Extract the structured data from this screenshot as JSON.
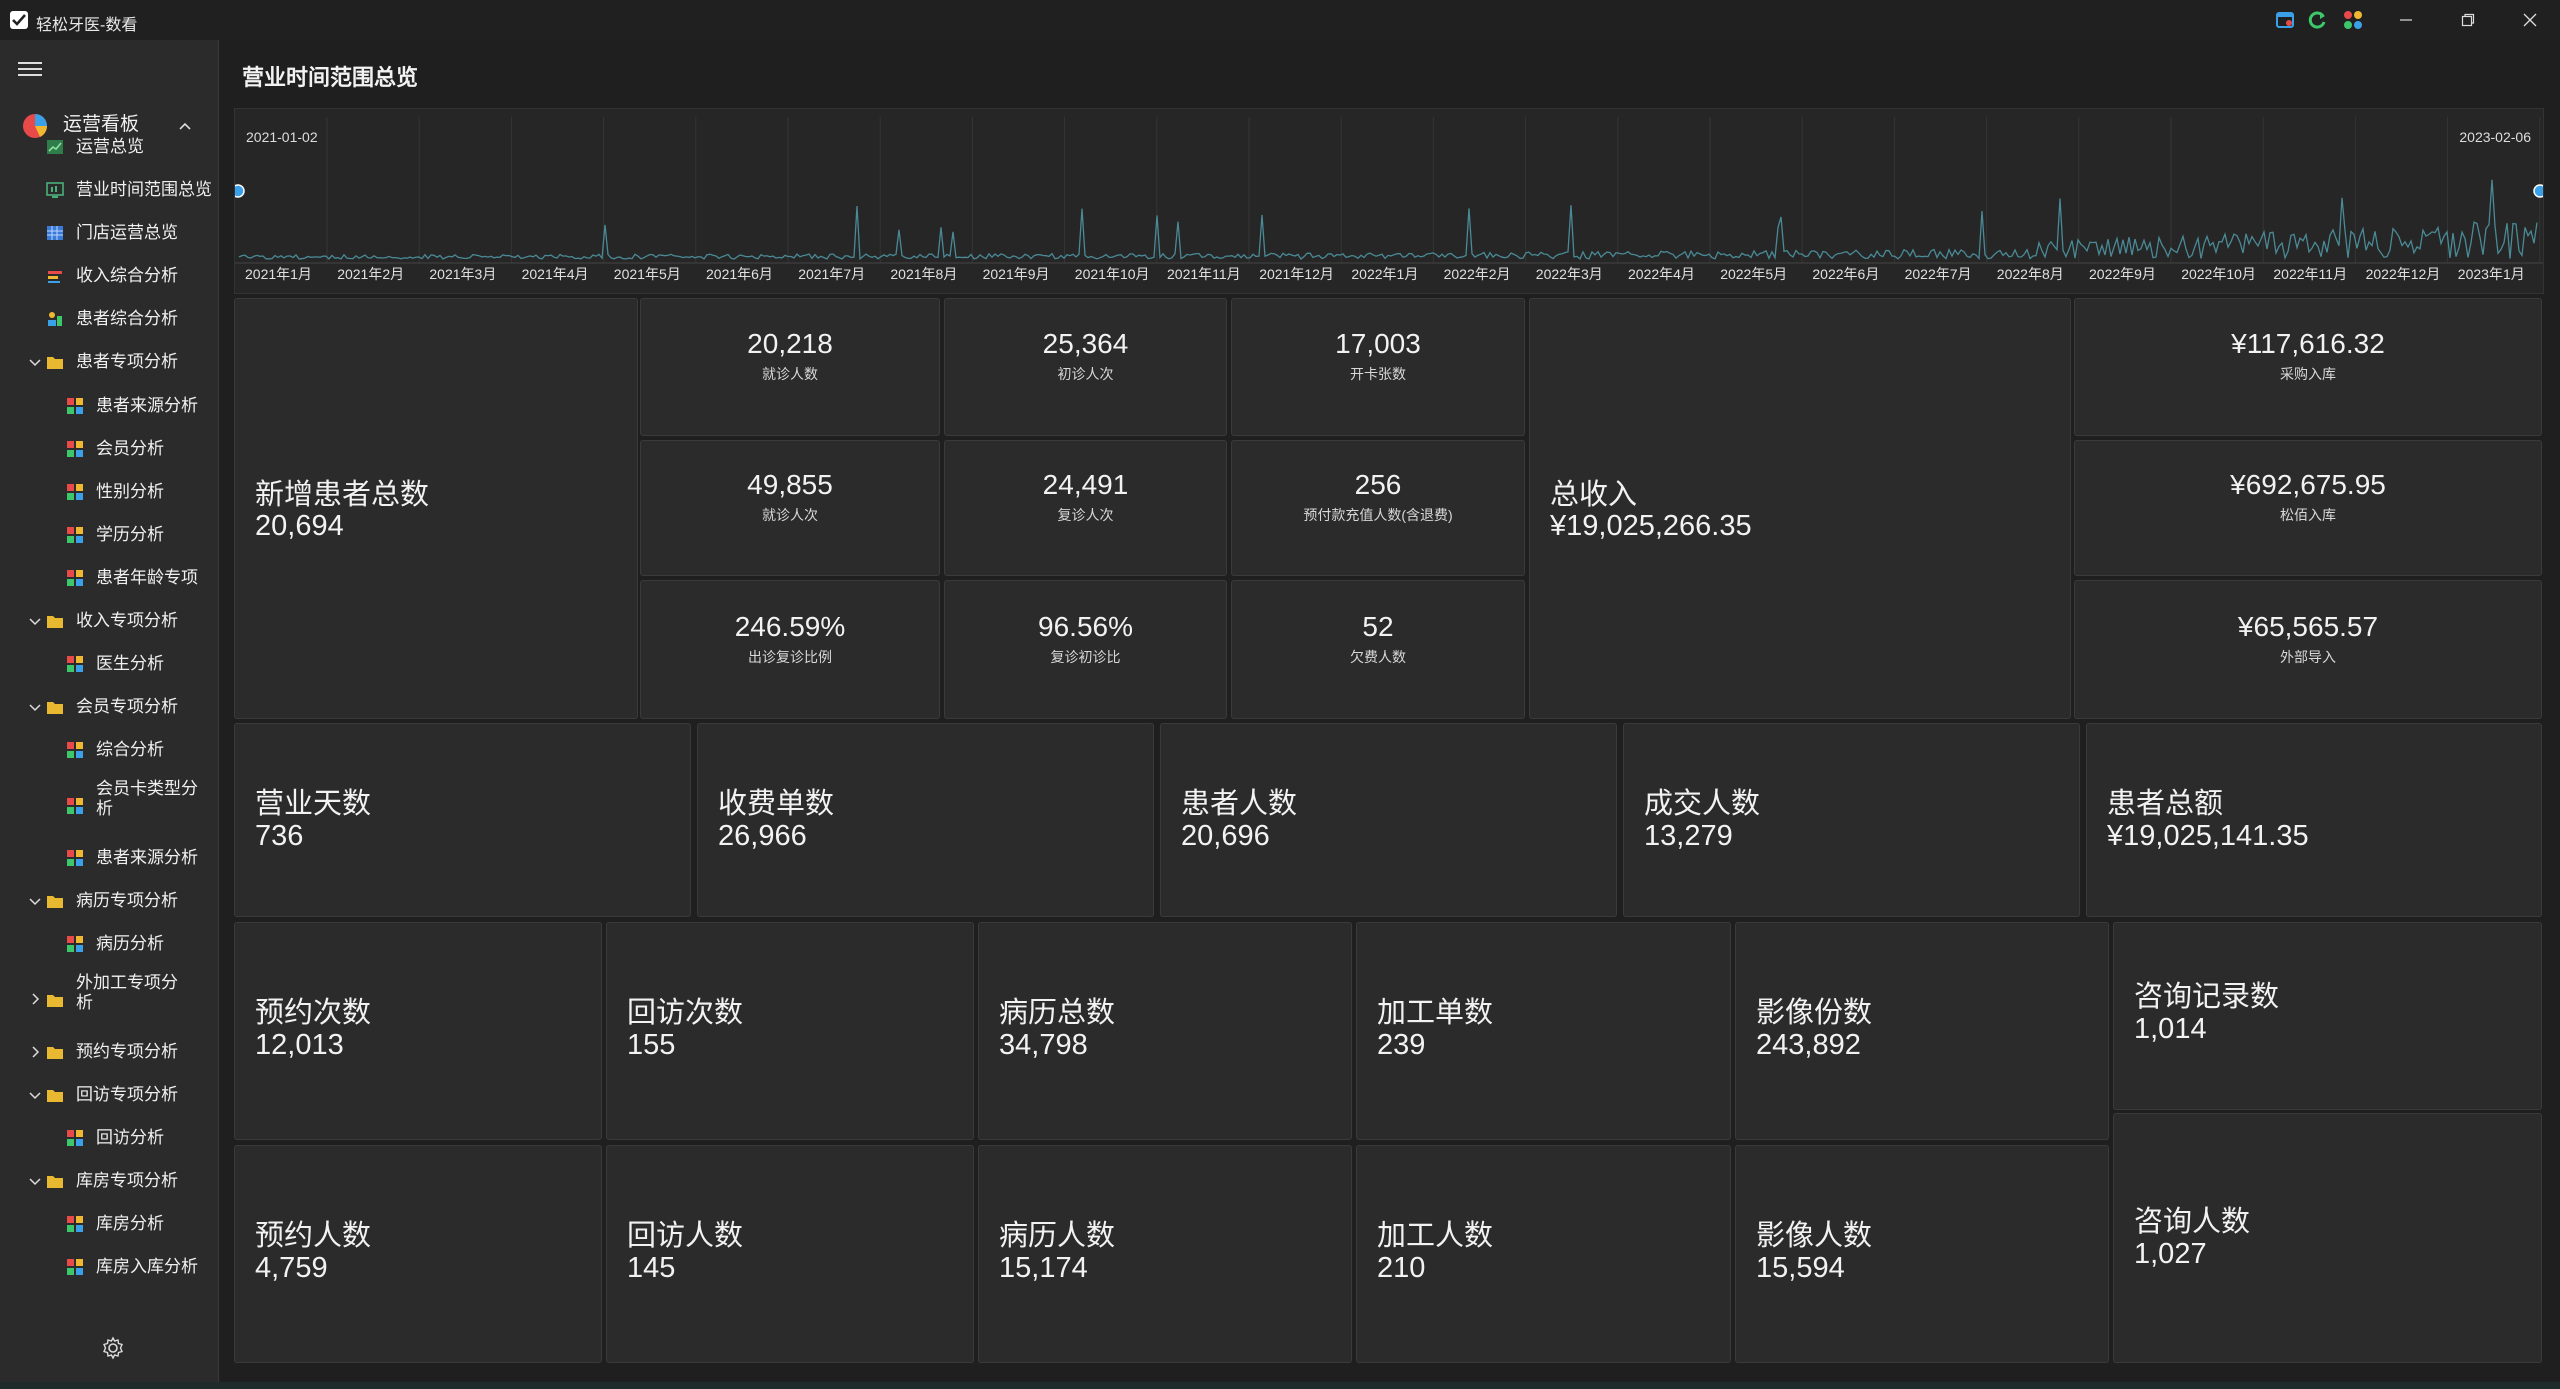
{
  "window": {
    "title": "轻松牙医-数看"
  },
  "sidebar": {
    "root": {
      "label": "运营看板"
    },
    "items": [
      {
        "label": "运营总览",
        "icon": "chart-line-icon"
      },
      {
        "label": "营业时间范围总览",
        "icon": "monitor-chart-icon"
      },
      {
        "label": "门店运营总览",
        "icon": "table-grid-icon"
      },
      {
        "label": "收入综合分析",
        "icon": "bar-chart-icon"
      },
      {
        "label": "患者综合分析",
        "icon": "people-chart-icon"
      },
      {
        "label": "患者专项分析",
        "icon": "folder-icon"
      },
      {
        "label": "患者来源分析",
        "icon": "widget-icon"
      },
      {
        "label": "会员分析",
        "icon": "widget-icon"
      },
      {
        "label": "性别分析",
        "icon": "widget-icon"
      },
      {
        "label": "学历分析",
        "icon": "widget-icon"
      },
      {
        "label": "患者年龄专项",
        "icon": "widget-icon"
      },
      {
        "label": "收入专项分析",
        "icon": "folder-icon"
      },
      {
        "label": "医生分析",
        "icon": "widget-icon"
      },
      {
        "label": "会员专项分析",
        "icon": "folder-icon"
      },
      {
        "label": "综合分析",
        "icon": "widget-icon"
      },
      {
        "label": "会员卡类型分析",
        "icon": "widget-icon"
      },
      {
        "label": "患者来源分析",
        "icon": "widget-icon"
      },
      {
        "label": "病历专项分析",
        "icon": "folder-icon"
      },
      {
        "label": "病历分析",
        "icon": "widget-icon"
      },
      {
        "label": "外加工专项分析",
        "icon": "folder-icon"
      },
      {
        "label": "预约专项分析",
        "icon": "folder-icon"
      },
      {
        "label": "回访专项分析",
        "icon": "folder-icon"
      },
      {
        "label": "回访分析",
        "icon": "widget-icon"
      },
      {
        "label": "库房专项分析",
        "icon": "folder-icon"
      },
      {
        "label": "库房分析",
        "icon": "widget-icon"
      },
      {
        "label": "库房入库分析",
        "icon": "widget-icon"
      }
    ]
  },
  "main": {
    "title": "营业时间范围总览",
    "timeline": {
      "start": "2021-01-02",
      "end": "2023-02-06",
      "months": [
        "2021年1月",
        "2021年2月",
        "2021年3月",
        "2021年4月",
        "2021年5月",
        "2021年6月",
        "2021年7月",
        "2021年8月",
        "2021年9月",
        "2021年10月",
        "2021年11月",
        "2021年12月",
        "2022年1月",
        "2022年2月",
        "2022年3月",
        "2022年4月",
        "2022年5月",
        "2022年6月",
        "2022年7月",
        "2022年8月",
        "2022年9月",
        "2022年10月",
        "2022年11月",
        "2022年12月",
        "2023年1月"
      ]
    },
    "new_patients": {
      "label": "新增患者总数",
      "value": "20,694"
    },
    "total_income": {
      "label": "总收入",
      "value": "¥19,025,266.35"
    },
    "small_stats": [
      {
        "value": "20,218",
        "label": "就诊人数"
      },
      {
        "value": "25,364",
        "label": "初诊人次"
      },
      {
        "value": "17,003",
        "label": "开卡张数"
      },
      {
        "value": "49,855",
        "label": "就诊人次"
      },
      {
        "value": "24,491",
        "label": "复诊人次"
      },
      {
        "value": "256",
        "label": "预付款充值人数(含退费)"
      },
      {
        "value": "246.59%",
        "label": "出诊复诊比例"
      },
      {
        "value": "96.56%",
        "label": "复诊初诊比"
      },
      {
        "value": "52",
        "label": "欠费人数"
      }
    ],
    "stock_stats": [
      {
        "value": "¥117,616.32",
        "label": "采购入库"
      },
      {
        "value": "¥692,675.95",
        "label": "松佰入库"
      },
      {
        "value": "¥65,565.57",
        "label": "外部导入"
      }
    ],
    "row2": [
      {
        "label": "营业天数",
        "value": "736"
      },
      {
        "label": "收费单数",
        "value": "26,966"
      },
      {
        "label": "患者人数",
        "value": "20,696"
      },
      {
        "label": "成交人数",
        "value": "13,279"
      },
      {
        "label": "患者总额",
        "value": "¥19,025,141.35"
      }
    ],
    "row3": [
      {
        "label": "预约次数",
        "value": "12,013"
      },
      {
        "label": "回访次数",
        "value": "155"
      },
      {
        "label": "病历总数",
        "value": "34,798"
      },
      {
        "label": "加工单数",
        "value": "239"
      },
      {
        "label": "影像份数",
        "value": "243,892"
      },
      {
        "label": "咨询记录数",
        "value": "1,014"
      }
    ],
    "row4": [
      {
        "label": "预约人数",
        "value": "4,759"
      },
      {
        "label": "回访人数",
        "value": "145"
      },
      {
        "label": "病历人数",
        "value": "15,174"
      },
      {
        "label": "加工人数",
        "value": "210"
      },
      {
        "label": "影像人数",
        "value": "15,594"
      },
      {
        "label": "咨询人数",
        "value": "1,027"
      }
    ]
  },
  "colors": {
    "background": "#1f1f1f",
    "card": "#2b2b2b",
    "sparkline": "#4a8a96",
    "accent_blue": "#3aa0e8",
    "folder": "#e8b830"
  }
}
